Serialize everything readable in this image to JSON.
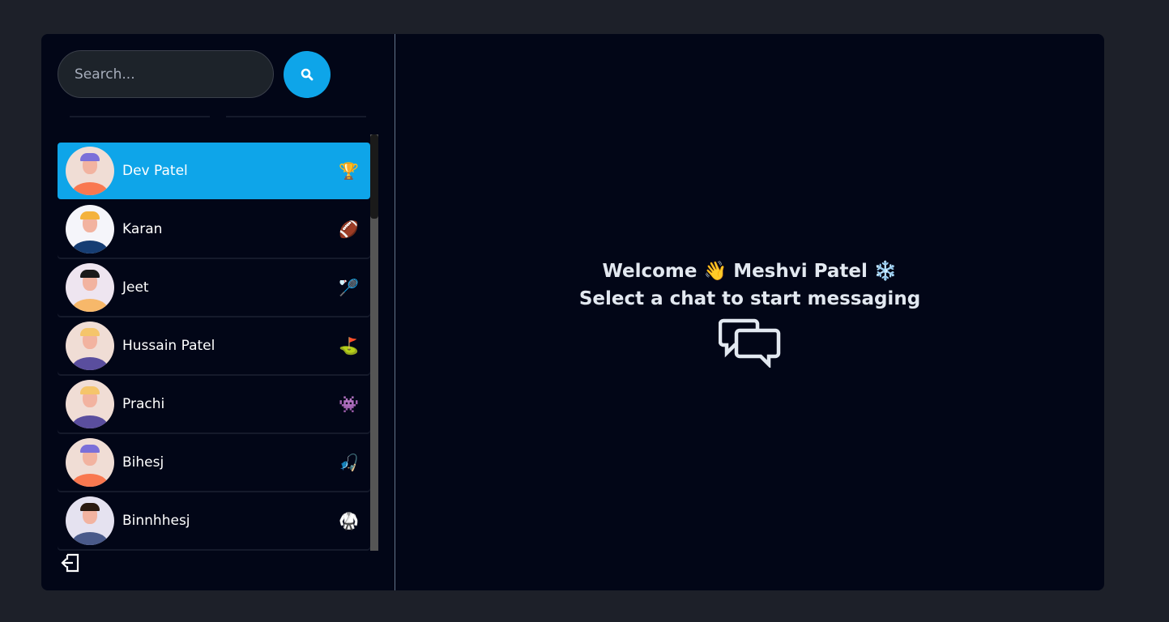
{
  "search": {
    "placeholder": "Search..."
  },
  "contacts": [
    {
      "name": "Dev Patel",
      "emoji": "🏆",
      "selected": true,
      "shirt": "#f97850",
      "hair": "#7b6fd9",
      "bg": "#f0ddd5"
    },
    {
      "name": "Karan",
      "emoji": "🏈",
      "shirt": "#163d73",
      "hair": "#f4b23c",
      "bg": "#f5f5fa"
    },
    {
      "name": "Jeet",
      "emoji": "🏸",
      "shirt": "#f7b86a",
      "hair": "#1a1a1a",
      "bg": "#eee5f0"
    },
    {
      "name": "Hussain Patel",
      "emoji": "⛳",
      "shirt": "#5a4e9e",
      "hair": "#f5c56b",
      "bg": "#f0ddd5"
    },
    {
      "name": "Prachi",
      "emoji": "👾",
      "shirt": "#5a4e9e",
      "hair": "#f5c56b",
      "bg": "#f0ddd5"
    },
    {
      "name": "Bihesj",
      "emoji": "🎣",
      "shirt": "#f97850",
      "hair": "#7b6fd9",
      "bg": "#f0ddd5"
    },
    {
      "name": "Binnhhesj",
      "emoji": "🥋",
      "shirt": "#4a5a8a",
      "hair": "#2a1a10",
      "bg": "#e5e2f0"
    }
  ],
  "welcome": {
    "line1_prefix": "Welcome",
    "wave": "👋",
    "user": "Meshvi Patel",
    "snow": "❄️",
    "line2": "Select a chat to start messaging"
  }
}
